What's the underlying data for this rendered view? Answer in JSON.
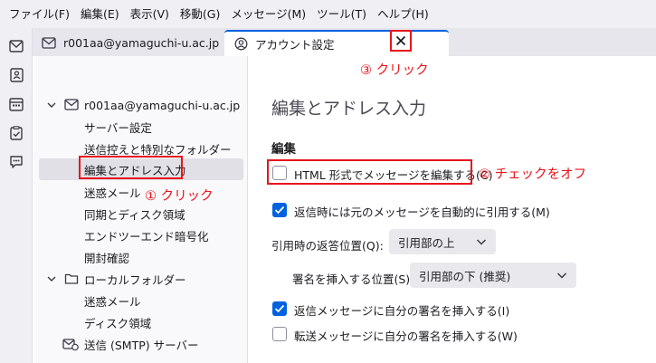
{
  "menu": [
    "ファイル(F)",
    "編集(E)",
    "表示(V)",
    "移動(G)",
    "メッセージ(M)",
    "ツール(T)",
    "ヘルプ(H)"
  ],
  "tabs": {
    "mail_tab": "r001aa@yamaguchi-u.ac.jp",
    "settings_tab": "アカウント設定"
  },
  "sidebar": {
    "account": "r001aa@yamaguchi-u.ac.jp",
    "account_items": [
      "サーバー設定",
      "送信控えと特別なフォルダー",
      "編集とアドレス入力",
      "迷惑メール",
      "同期とディスク領域",
      "エンドツーエンド暗号化",
      "開封確認"
    ],
    "local_folders": "ローカルフォルダー",
    "local_items": [
      "迷惑メール",
      "ディスク領域"
    ],
    "smtp": "送信 (SMTP) サーバー"
  },
  "content": {
    "page_title": "編集とアドレス入力",
    "section": "編集",
    "html_compose": {
      "label": "HTML 形式でメッセージを編集する(C)",
      "checked": false
    },
    "auto_quote": {
      "label": "返信時には元のメッセージを自動的に引用する(M)",
      "checked": true
    },
    "reply_pos_label": "引用時の返答位置(Q):",
    "reply_pos_value": "引用部の上",
    "sig_pos_label": "署名を挿入する位置(S):",
    "sig_pos_value": "引用部の下 (推奨)",
    "sig_reply": {
      "label": "返信メッセージに自分の署名を挿入する(I)",
      "checked": true
    },
    "sig_forward": {
      "label": "転送メッセージに自分の署名を挿入する(W)",
      "checked": false
    }
  },
  "annotations": {
    "step1": "① クリック",
    "step2": "② チェックをオフ",
    "step3": "③ クリック"
  },
  "colors": {
    "accent": "#0061e0",
    "annotation": "#e8141b"
  }
}
